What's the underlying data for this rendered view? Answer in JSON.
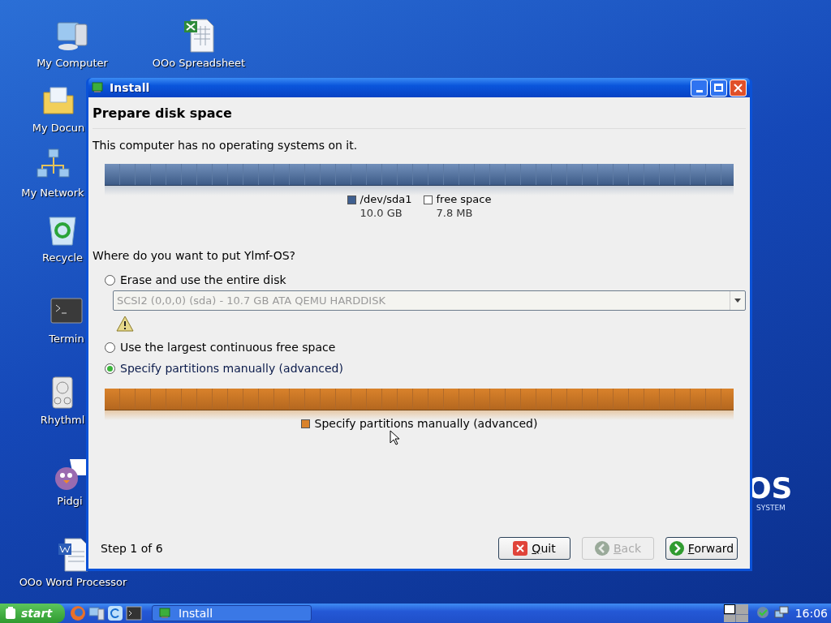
{
  "desktop_icons": [
    {
      "label": "My Computer",
      "kind": "computer"
    },
    {
      "label": "OOo Spreadsheet",
      "kind": "spreadsheet"
    },
    {
      "label": "My Docun",
      "kind": "folder"
    },
    {
      "label": "My Network",
      "kind": "network"
    },
    {
      "label": "Recycle",
      "kind": "trash"
    },
    {
      "label": "Termin",
      "kind": "terminal"
    },
    {
      "label": "Rhythml",
      "kind": "audio"
    },
    {
      "label": "Pidgi",
      "kind": "chat"
    },
    {
      "label": "OOo Word Processor",
      "kind": "document"
    }
  ],
  "logo": {
    "text": "OS",
    "subtitle": "SYSTEM"
  },
  "window": {
    "title": "Install",
    "heading": "Prepare disk space",
    "intro": "This computer has no operating systems on it.",
    "disk_bar": {
      "partitions": [
        {
          "name": "/dev/sda1",
          "size": "10.0 GB",
          "color": "#3f5f8f"
        },
        {
          "name": "free space",
          "size": "7.8 MB",
          "color": "#ffffff"
        }
      ]
    },
    "question": "Where do you want to put Ylmf-OS?",
    "options": [
      {
        "label": "Erase and use the entire disk",
        "selected": false,
        "disk_select": {
          "value": "SCSI2 (0,0,0) (sda) - 10.7 GB ATA QEMU HARDDISK",
          "disabled": true
        },
        "warning": true
      },
      {
        "label": "Use the largest continuous free space",
        "selected": false
      },
      {
        "label": "Specify partitions manually (advanced)",
        "selected": true
      }
    ],
    "result_bar": {
      "legend": [
        {
          "label": "Specify partitions manually (advanced)",
          "color": "#d9822b"
        }
      ]
    },
    "step": "Step 1 of 6",
    "buttons": [
      {
        "label": "Quit",
        "kind": "quit",
        "disabled": false
      },
      {
        "label": "Back",
        "kind": "back",
        "disabled": true
      },
      {
        "label": "Forward",
        "kind": "forward",
        "disabled": false
      }
    ]
  },
  "taskbar": {
    "start": "start",
    "tasks": [
      {
        "label": "Install",
        "selected": false
      }
    ],
    "workspaces": [
      {
        "selected": true
      },
      {
        "selected": false
      },
      {
        "selected": false
      },
      {
        "selected": false
      }
    ],
    "clock": "16:06"
  }
}
